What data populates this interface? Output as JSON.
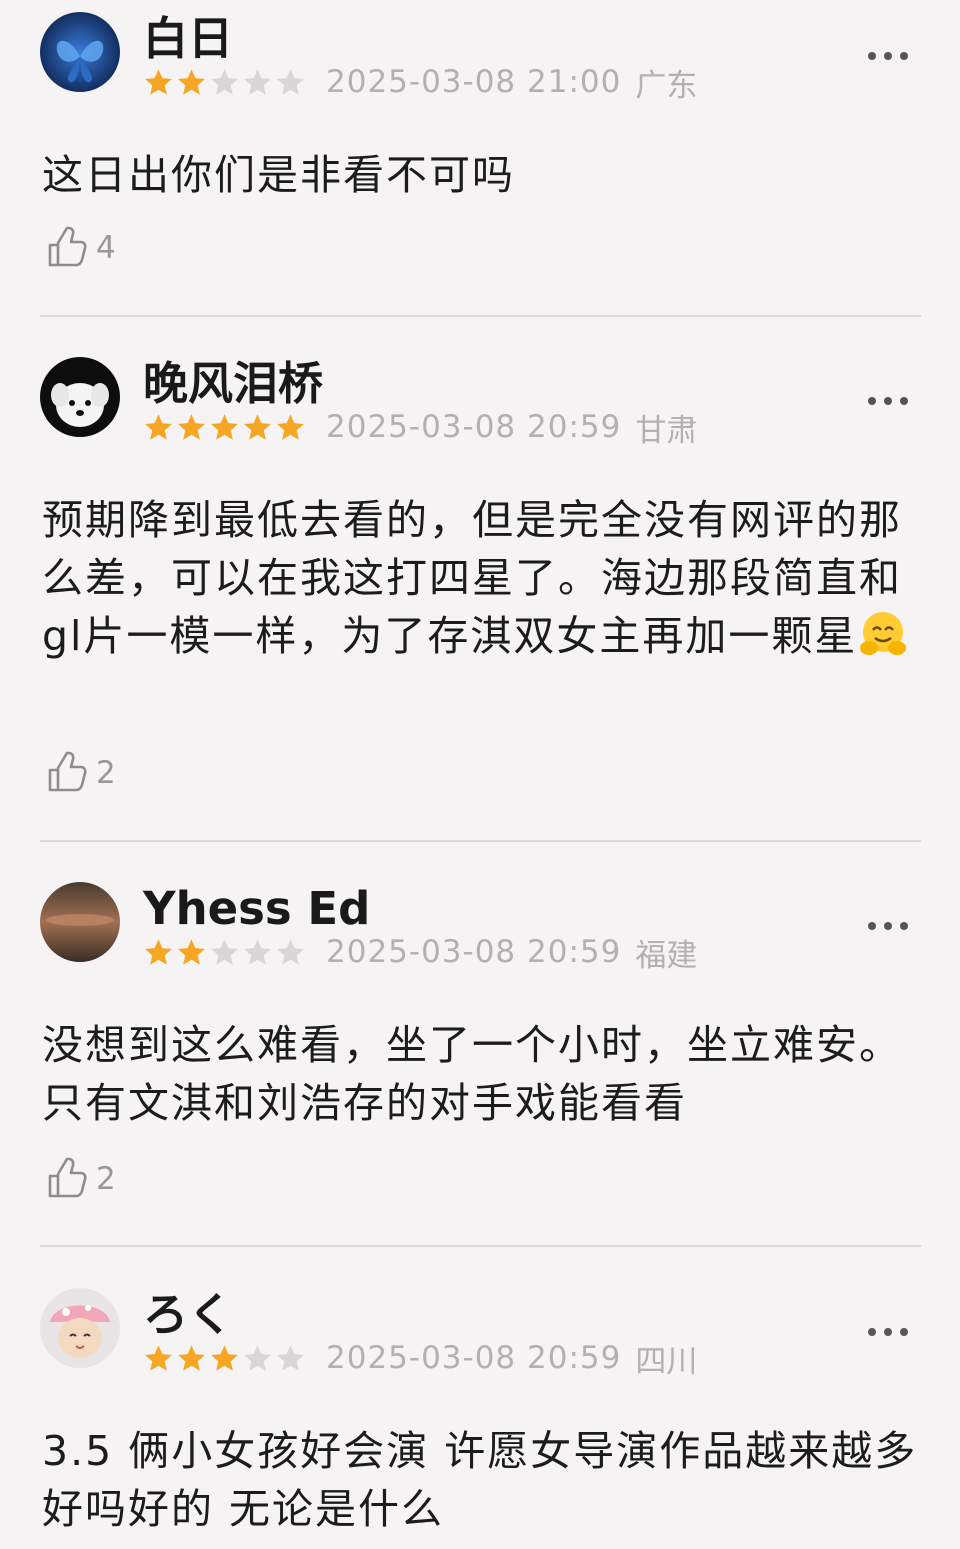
{
  "reviews": [
    {
      "username": "白日",
      "rating": 2,
      "max_rating": 5,
      "timestamp": "2025-03-08 21:00",
      "location": "广东",
      "content": "这日出你们是非看不可吗",
      "likes": "4",
      "avatar_icon": "blue-butterfly-avatar"
    },
    {
      "username": "晚风泪桥",
      "rating": 5,
      "max_rating": 5,
      "timestamp": "2025-03-08 20:59",
      "location": "甘肃",
      "content": "预期降到最低去看的，但是完全没有网评的那么差，可以在我这打四星了。海边那段简直和gl片一模一样，为了存淇双女主再加一颗星",
      "content_emoji": "hugging-face-emoji",
      "likes": "2",
      "avatar_icon": "white-puppy-avatar"
    },
    {
      "username": "Yhess Ed",
      "rating": 2,
      "max_rating": 5,
      "timestamp": "2025-03-08 20:59",
      "location": "福建",
      "content": "没想到这么难看，坐了一个小时，坐立难安。只有文淇和刘浩存的对手戏能看看",
      "likes": "2",
      "avatar_icon": "sunset-sky-avatar"
    },
    {
      "username": "ろく",
      "rating": 3,
      "max_rating": 5,
      "timestamp": "2025-03-08 20:59",
      "location": "四川",
      "content": "3.5 俩小女孩好会演 许愿女导演作品越来越多好吗好的 无论是什么",
      "avatar_icon": "plush-doll-avatar"
    }
  ],
  "colors": {
    "star_filled": "#f5a623",
    "star_empty": "#d9d6d8",
    "background": "#f6f3f5",
    "meta_text": "#b3b0b2"
  },
  "icons": {
    "like": "thumbs-up-icon",
    "more": "more-options-icon"
  }
}
